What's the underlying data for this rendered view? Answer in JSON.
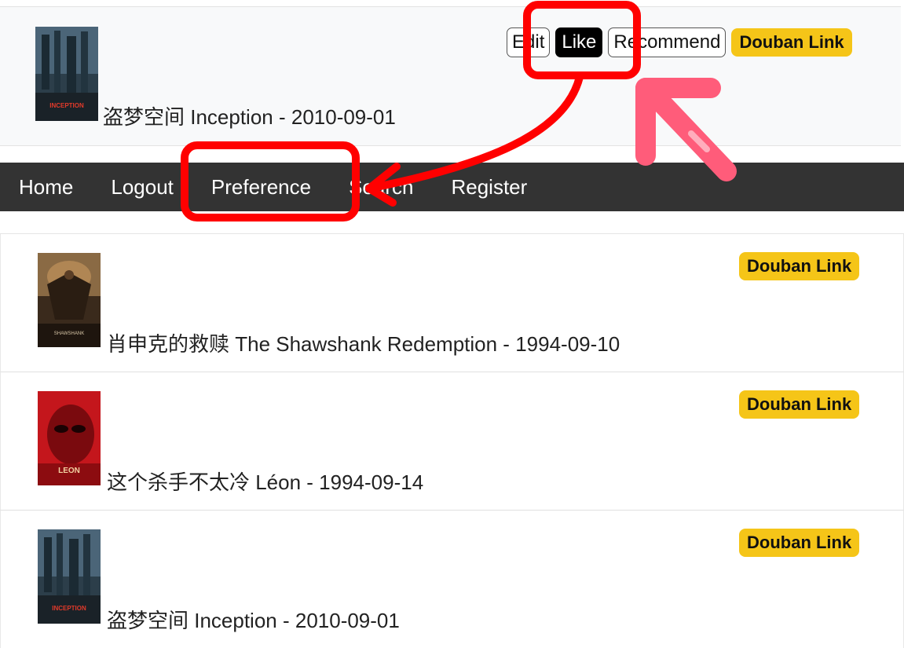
{
  "top_movie": {
    "title": "盗梦空间 Inception - 2010-09-01",
    "actions": {
      "edit_label": "Edit",
      "like_label": "Like",
      "recommend_label": "Recommend",
      "douban_label": "Douban Link"
    }
  },
  "nav": {
    "home": "Home",
    "logout": "Logout",
    "preference": "Preference",
    "search": "Search",
    "register": "Register"
  },
  "movies": [
    {
      "title": "肖申克的救赎 The Shawshank Redemption - 1994-09-10",
      "douban_label": "Douban Link",
      "poster": "shawshank-poster"
    },
    {
      "title": "这个杀手不太冷 Léon - 1994-09-14",
      "douban_label": "Douban Link",
      "poster": "leon-poster"
    },
    {
      "title": "盗梦空间 Inception - 2010-09-01",
      "douban_label": "Douban Link",
      "poster": "inception-poster"
    }
  ],
  "poster_text": {
    "inception": "INCEPTION",
    "shawshank": "SHAWSHANK",
    "leon": "LEON"
  },
  "colors": {
    "annotation_red": "#ff0000",
    "pink_arrow": "#ff5c7a",
    "douban_yellow": "#f5c518",
    "navbar_bg": "#333333"
  }
}
